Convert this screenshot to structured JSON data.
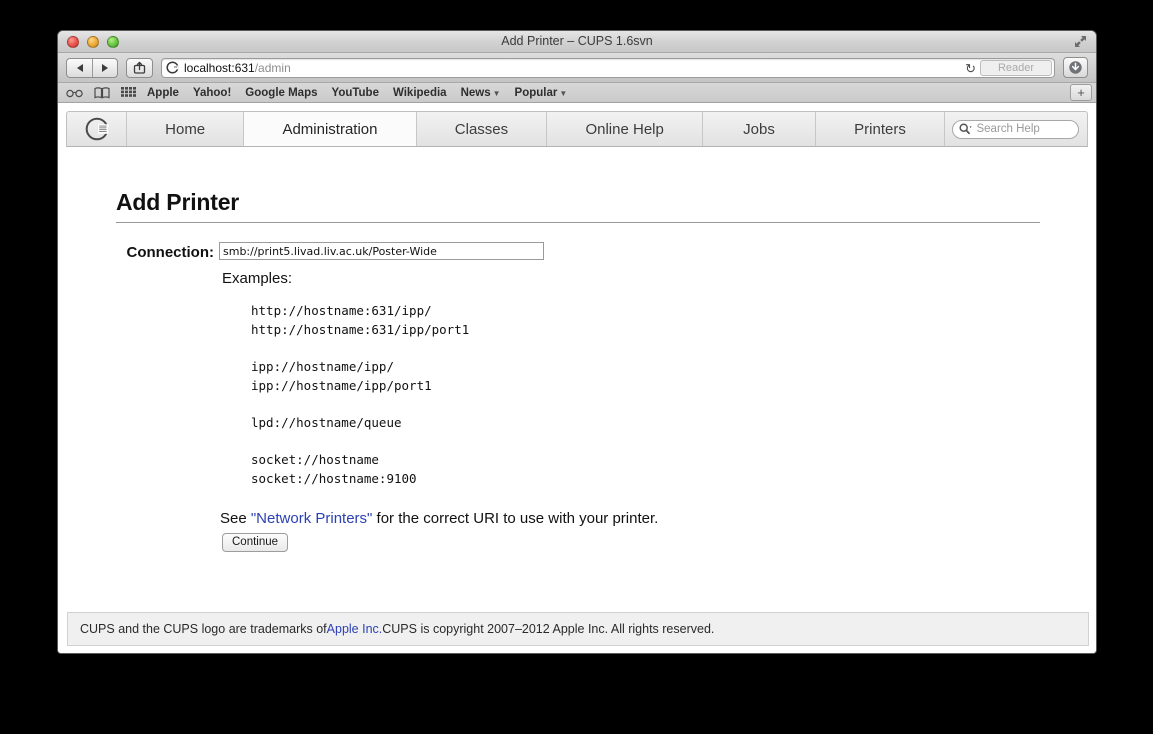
{
  "window": {
    "title": "Add Printer – CUPS 1.6svn",
    "traffic_lights": [
      "close",
      "minimize",
      "zoom"
    ],
    "fullscreen_icon": "fullscreen-arrows-icon"
  },
  "toolbar": {
    "back_icon": "back-arrow-icon",
    "forward_icon": "forward-arrow-icon",
    "share_icon": "share-icon",
    "favicon": "cups-favicon",
    "url_main": "localhost:631",
    "url_path": "/admin",
    "reload_icon": "reload-icon",
    "reader_label": "Reader",
    "downloads_icon": "downloads-icon"
  },
  "bookmarks_bar": {
    "icons": [
      {
        "name": "reading-list-icon",
        "glyph": "ͦͦ"
      },
      {
        "name": "bookmarks-book-icon",
        "glyph": "book"
      },
      {
        "name": "top-sites-grid-icon",
        "glyph": "grid"
      }
    ],
    "items": [
      {
        "label": "Apple",
        "has_caret": false
      },
      {
        "label": "Yahoo!",
        "has_caret": false
      },
      {
        "label": "Google Maps",
        "has_caret": false
      },
      {
        "label": "YouTube",
        "has_caret": false
      },
      {
        "label": "Wikipedia",
        "has_caret": false
      },
      {
        "label": "News",
        "has_caret": true
      },
      {
        "label": "Popular",
        "has_caret": true
      }
    ],
    "caret_glyph": "▼",
    "add_tab_label": "+"
  },
  "cups_nav": {
    "logo_name": "cups-logo-icon",
    "tabs": [
      {
        "label": "Home",
        "active": false
      },
      {
        "label": "Administration",
        "active": true
      },
      {
        "label": "Classes",
        "active": false
      },
      {
        "label": "Online Help",
        "active": false
      },
      {
        "label": "Jobs",
        "active": false
      },
      {
        "label": "Printers",
        "active": false
      }
    ],
    "search_placeholder": "Search Help",
    "search_icon": "search-magnifier-icon"
  },
  "main": {
    "heading": "Add Printer",
    "connection_label": "Connection:",
    "connection_value": "smb://print5.livad.liv.ac.uk/Poster-Wide",
    "examples_label": "Examples:",
    "example_groups": [
      [
        "http://hostname:631/ipp/",
        "http://hostname:631/ipp/port1"
      ],
      [
        "ipp://hostname/ipp/",
        "ipp://hostname/ipp/port1"
      ],
      [
        "lpd://hostname/queue"
      ],
      [
        "socket://hostname",
        "socket://hostname:9100"
      ]
    ],
    "see_prefix": "See ",
    "see_link": "\"Network Printers\"",
    "see_suffix": " for the correct URI to use with your printer.",
    "continue_label": "Continue"
  },
  "footer": {
    "text_before_link": "CUPS and the CUPS logo are trademarks of ",
    "link": "Apple Inc.",
    "text_after_link": " CUPS is copyright 2007–2012 Apple Inc. All rights reserved."
  },
  "colors": {
    "link": "#2c41b5",
    "active_tab_bg": "#fbfbfb",
    "page_bg": "#ffffff",
    "footer_bg": "#f0f0f0"
  }
}
